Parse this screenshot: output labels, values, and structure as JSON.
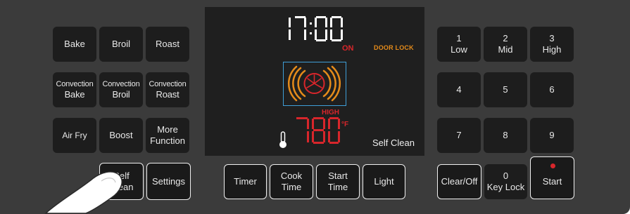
{
  "colors": {
    "panel": "#3b3b3b",
    "key": "#1d1d1d",
    "display_red": "#d8262b",
    "display_orange": "#e58b1a",
    "display_blue": "#3f9fd8"
  },
  "mode_keys": {
    "bake": "Bake",
    "broil": "Broil",
    "roast": "Roast",
    "conv_bake": [
      "Convection",
      "Bake"
    ],
    "conv_broil": [
      "Convection",
      "Broil"
    ],
    "conv_roast": [
      "Convection",
      "Roast"
    ],
    "air_fry": "Air Fry",
    "boost": "Boost",
    "more_function": [
      "More",
      "Function"
    ],
    "self_clean": [
      "Self",
      "Clean"
    ],
    "settings": "Settings"
  },
  "bottom_keys": {
    "timer": "Timer",
    "cook_time": [
      "Cook",
      "Time"
    ],
    "start_time": [
      "Start",
      "Time"
    ],
    "light": "Light"
  },
  "number_keys": [
    {
      "num": "1",
      "label": "Low"
    },
    {
      "num": "2",
      "label": "Mid"
    },
    {
      "num": "3",
      "label": "High"
    },
    {
      "num": "4",
      "label": ""
    },
    {
      "num": "5",
      "label": ""
    },
    {
      "num": "6",
      "label": ""
    },
    {
      "num": "7",
      "label": ""
    },
    {
      "num": "8",
      "label": ""
    },
    {
      "num": "9",
      "label": ""
    }
  ],
  "right_keys": {
    "clear_off": "Clear/Off",
    "zero_num": "0",
    "key_lock": "Key Lock",
    "start": "Start"
  },
  "display": {
    "clock": "17:00",
    "on": "ON",
    "door_lock": "DOOR LOCK",
    "level": "HIGH",
    "temperature": "780",
    "unit": "°F",
    "mode": "Self Clean",
    "icons": [
      "fan-icon",
      "thermometer-icon"
    ]
  }
}
